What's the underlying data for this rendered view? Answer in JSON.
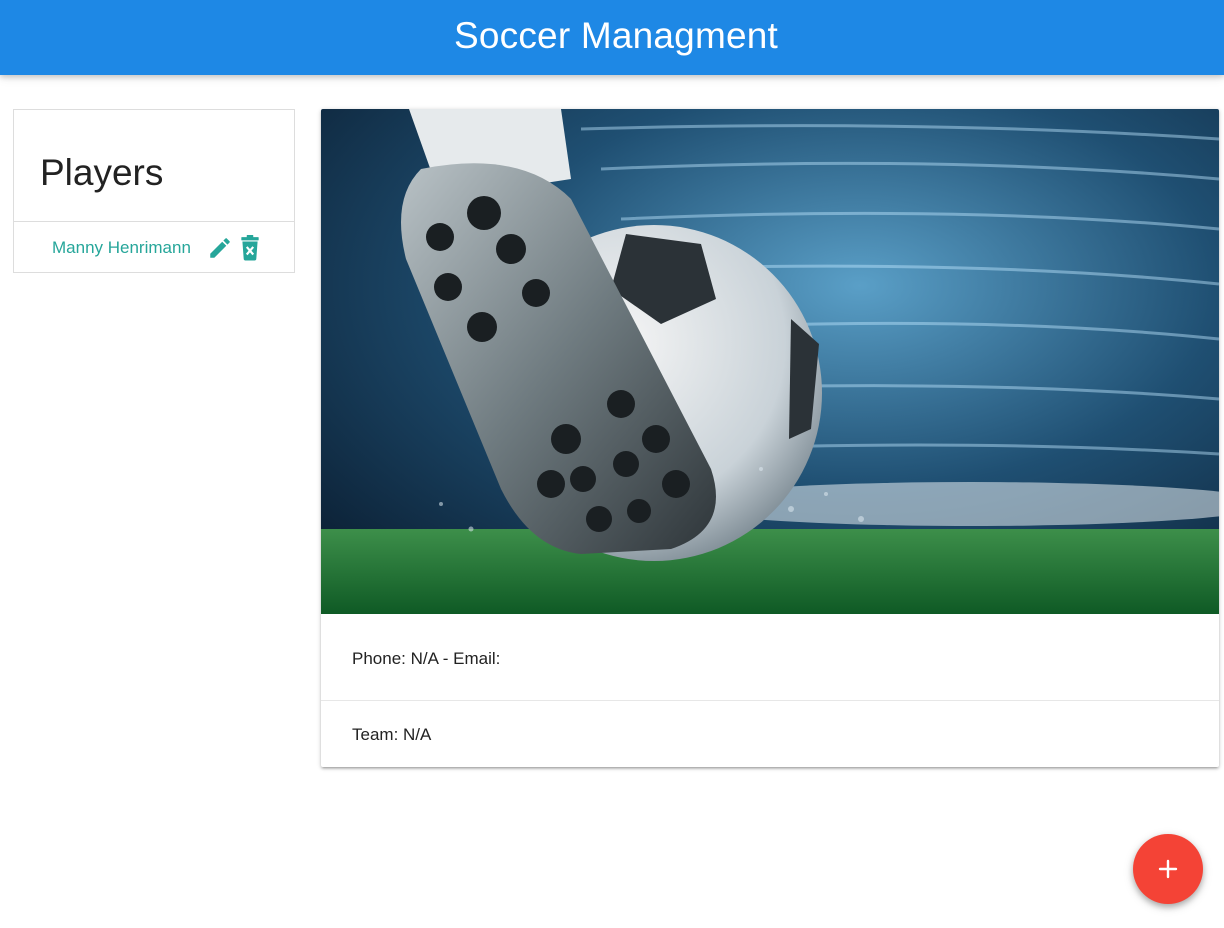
{
  "navbar": {
    "brand": "Soccer Managment",
    "color": "#1e88e5"
  },
  "players_panel": {
    "title": "Players",
    "items": [
      {
        "name": "Manny Henrimann",
        "edit_icon": "pencil-icon",
        "delete_icon": "trash-x-icon"
      }
    ],
    "accent_color": "#26a69a"
  },
  "player_card": {
    "image": "soccer-cleat-kicking-ball-photo",
    "contact_line": "Phone: N/A - Email:",
    "team_line": "Team: N/A"
  },
  "fab": {
    "icon": "plus-icon",
    "color": "#f44336"
  }
}
